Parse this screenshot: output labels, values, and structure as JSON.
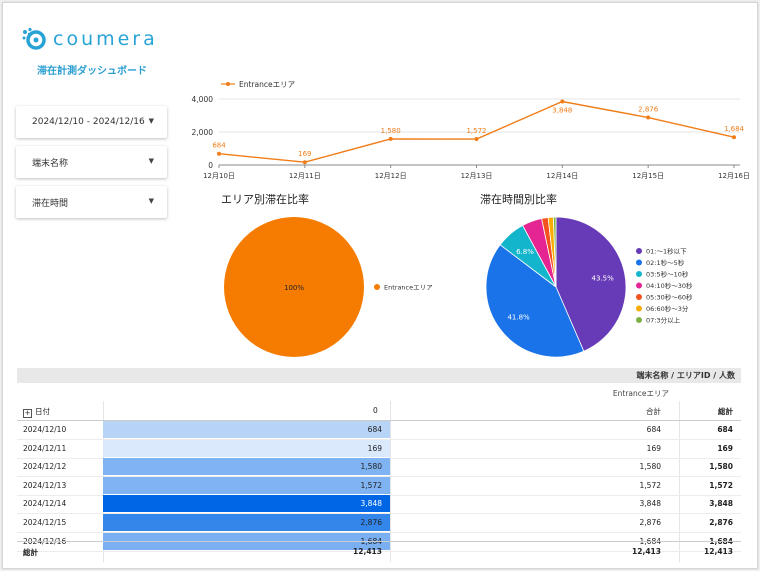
{
  "logo": {
    "text": "coumera"
  },
  "dashboard_title": "滞在計測ダッシュボード",
  "filters": [
    {
      "label": "2024/12/10 - 2024/12/16"
    },
    {
      "label": "端末名称"
    },
    {
      "label": "滞在時間"
    }
  ],
  "colors": {
    "accent": "#2b9fd1",
    "line": "#f07d18",
    "pie_single": "#f57c00"
  },
  "chart_data": [
    {
      "type": "line",
      "series": [
        {
          "name": "Entranceエリア",
          "values": [
            684,
            169,
            1580,
            1572,
            3848,
            2876,
            1684
          ]
        }
      ],
      "x": [
        "12月10日",
        "12月11日",
        "12月12日",
        "12月13日",
        "12月14日",
        "12月15日",
        "12月16日"
      ],
      "data_labels": [
        "684",
        "169",
        "1,580",
        "1,572",
        "3,848",
        "2,876",
        "1,684"
      ],
      "y_ticks": [
        "0",
        "2,000",
        "4,000"
      ],
      "ylim": [
        0,
        4000
      ],
      "legend": "top-left"
    },
    {
      "type": "pie",
      "title": "エリア別滞在比率",
      "slices": [
        {
          "name": "Entranceエリア",
          "value": 100,
          "label": "100%",
          "color": "#f57c00"
        }
      ],
      "legend": "right"
    },
    {
      "type": "pie",
      "title": "滞在時間別比率",
      "slices": [
        {
          "name": "01:～1秒以下",
          "value": 43.5,
          "label": "43.5%",
          "color": "#673ab7"
        },
        {
          "name": "02:1秒～5秒",
          "value": 41.8,
          "label": "41.8%",
          "color": "#1a73e8"
        },
        {
          "name": "03:5秒～10秒",
          "value": 6.8,
          "label": "6.8%",
          "color": "#12b5cb"
        },
        {
          "name": "04:10秒～30秒",
          "value": 4.6,
          "label": "",
          "color": "#e52592"
        },
        {
          "name": "05:30秒～60秒",
          "value": 1.5,
          "label": "",
          "color": "#f4511e"
        },
        {
          "name": "06:60秒～3分",
          "value": 1.2,
          "label": "",
          "color": "#f9ab00"
        },
        {
          "name": "07:3分以上",
          "value": 0.6,
          "label": "",
          "color": "#7cb342"
        }
      ],
      "legend": "right"
    }
  ],
  "table": {
    "header_right": "端末名称 / エリアID / 人数",
    "sub_header": "Entranceエリア",
    "date_col": "日付",
    "bar_col_header": "0",
    "total_col_header": "合計",
    "sum_col_header": "総計",
    "max_value": 3848,
    "rows": [
      {
        "date": "2024/12/10",
        "value": "684",
        "raw": 684,
        "total": "684",
        "sum": "684"
      },
      {
        "date": "2024/12/11",
        "value": "169",
        "raw": 169,
        "total": "169",
        "sum": "169"
      },
      {
        "date": "2024/12/12",
        "value": "1,580",
        "raw": 1580,
        "total": "1,580",
        "sum": "1,580"
      },
      {
        "date": "2024/12/13",
        "value": "1,572",
        "raw": 1572,
        "total": "1,572",
        "sum": "1,572"
      },
      {
        "date": "2024/12/14",
        "value": "3,848",
        "raw": 3848,
        "total": "3,848",
        "sum": "3,848"
      },
      {
        "date": "2024/12/15",
        "value": "2,876",
        "raw": 2876,
        "total": "2,876",
        "sum": "2,876"
      },
      {
        "date": "2024/12/16",
        "value": "1,684",
        "raw": 1684,
        "total": "1,684",
        "sum": "1,684"
      }
    ],
    "footer": {
      "label": "総計",
      "value": "12,413",
      "total": "12,413",
      "sum": "12,413"
    }
  }
}
